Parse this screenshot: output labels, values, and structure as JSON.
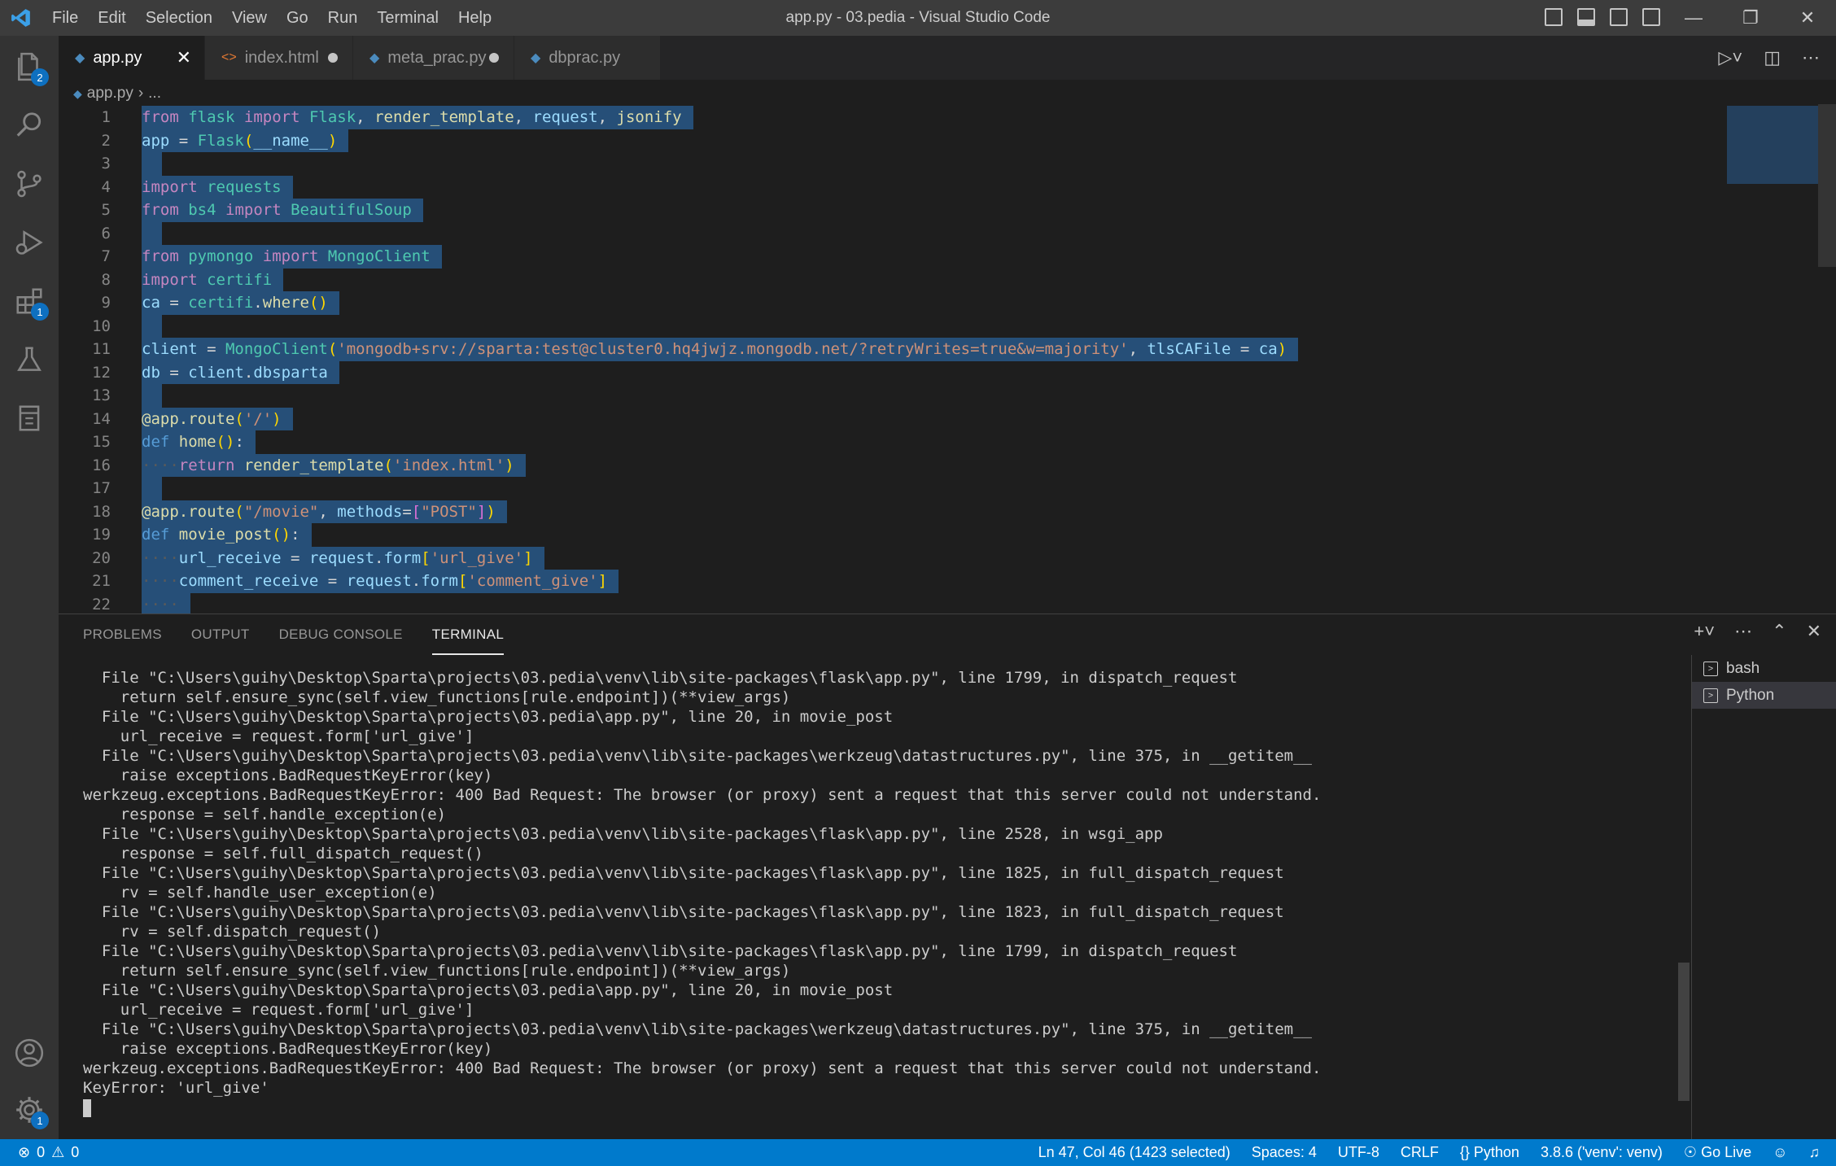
{
  "window": {
    "title": "app.py - 03.pedia - Visual Studio Code",
    "menu": [
      "File",
      "Edit",
      "Selection",
      "View",
      "Go",
      "Run",
      "Terminal",
      "Help"
    ]
  },
  "activity_bar": {
    "explorer_badge": "2",
    "extensions_badge": "1",
    "settings_badge": "1"
  },
  "tabs": [
    {
      "label": "app.py",
      "active": true,
      "dirty": false
    },
    {
      "label": "index.html",
      "active": false,
      "dirty": true
    },
    {
      "label": "meta_prac.py",
      "active": false,
      "dirty": true
    },
    {
      "label": "dbprac.py",
      "active": false,
      "dirty": false
    }
  ],
  "breadcrumb": {
    "file": "app.py",
    "rest": "..."
  },
  "editor": {
    "line_numbers": [
      "1",
      "2",
      "3",
      "4",
      "5",
      "6",
      "7",
      "8",
      "9",
      "10",
      "11",
      "12",
      "13",
      "14",
      "15",
      "16",
      "17",
      "18",
      "19",
      "20",
      "21",
      "22"
    ]
  },
  "panel": {
    "tabs": [
      "PROBLEMS",
      "OUTPUT",
      "DEBUG CONSOLE",
      "TERMINAL"
    ],
    "active_tab": "TERMINAL",
    "terminal_lines": [
      "  File \"C:\\Users\\guihy\\Desktop\\Sparta\\projects\\03.pedia\\venv\\lib\\site-packages\\flask\\app.py\", line 1799, in dispatch_request",
      "    return self.ensure_sync(self.view_functions[rule.endpoint])(**view_args)",
      "  File \"C:\\Users\\guihy\\Desktop\\Sparta\\projects\\03.pedia\\app.py\", line 20, in movie_post",
      "    url_receive = request.form['url_give']",
      "  File \"C:\\Users\\guihy\\Desktop\\Sparta\\projects\\03.pedia\\venv\\lib\\site-packages\\werkzeug\\datastructures.py\", line 375, in __getitem__",
      "    raise exceptions.BadRequestKeyError(key)",
      "werkzeug.exceptions.BadRequestKeyError: 400 Bad Request: The browser (or proxy) sent a request that this server could not understand.",
      "    response = self.handle_exception(e)",
      "  File \"C:\\Users\\guihy\\Desktop\\Sparta\\projects\\03.pedia\\venv\\lib\\site-packages\\flask\\app.py\", line 2528, in wsgi_app",
      "    response = self.full_dispatch_request()",
      "  File \"C:\\Users\\guihy\\Desktop\\Sparta\\projects\\03.pedia\\venv\\lib\\site-packages\\flask\\app.py\", line 1825, in full_dispatch_request",
      "    rv = self.handle_user_exception(e)",
      "  File \"C:\\Users\\guihy\\Desktop\\Sparta\\projects\\03.pedia\\venv\\lib\\site-packages\\flask\\app.py\", line 1823, in full_dispatch_request",
      "    rv = self.dispatch_request()",
      "  File \"C:\\Users\\guihy\\Desktop\\Sparta\\projects\\03.pedia\\venv\\lib\\site-packages\\flask\\app.py\", line 1799, in dispatch_request",
      "    return self.ensure_sync(self.view_functions[rule.endpoint])(**view_args)",
      "  File \"C:\\Users\\guihy\\Desktop\\Sparta\\projects\\03.pedia\\app.py\", line 20, in movie_post",
      "    url_receive = request.form['url_give']",
      "  File \"C:\\Users\\guihy\\Desktop\\Sparta\\projects\\03.pedia\\venv\\lib\\site-packages\\werkzeug\\datastructures.py\", line 375, in __getitem__",
      "    raise exceptions.BadRequestKeyError(key)",
      "werkzeug.exceptions.BadRequestKeyError: 400 Bad Request: The browser (or proxy) sent a request that this server could not understand.",
      "KeyError: 'url_give'"
    ],
    "terminal_instances": [
      {
        "label": "bash",
        "selected": false
      },
      {
        "label": "Python",
        "selected": true
      }
    ]
  },
  "statusbar": {
    "errors": "0",
    "warnings": "0",
    "position": "Ln 47, Col 46 (1423 selected)",
    "spaces": "Spaces: 4",
    "encoding": "UTF-8",
    "eol": "CRLF",
    "language": "Python",
    "interpreter": "3.8.6 ('venv': venv)",
    "golive": "Go Live"
  },
  "colors": {
    "accent": "#007acc",
    "selection": "#264f78",
    "keyword": "#c586c0",
    "string": "#ce9178",
    "function": "#dcdcaa",
    "class": "#4ec9b0",
    "variable": "#9cdcfe"
  }
}
